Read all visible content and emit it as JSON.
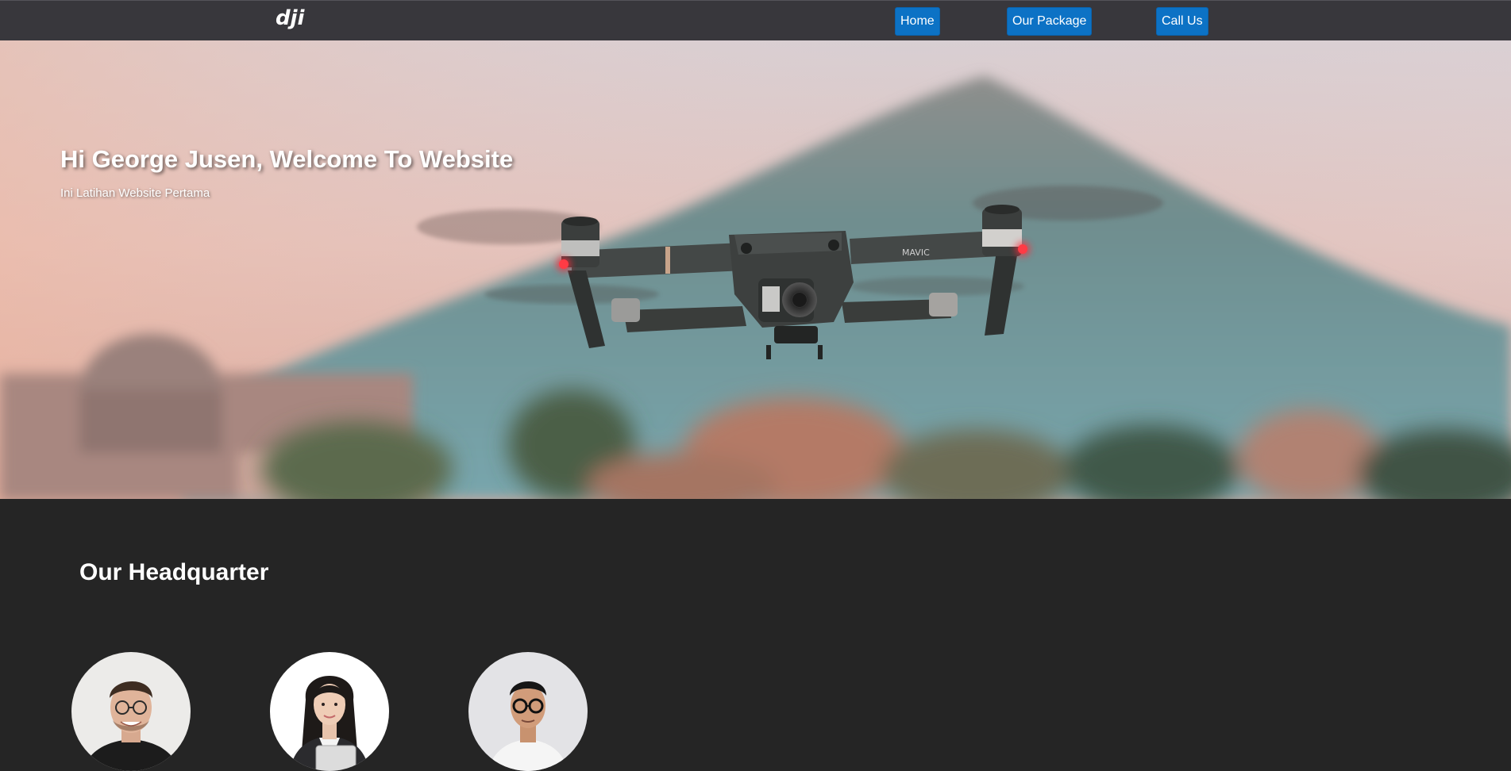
{
  "navbar": {
    "logo_text": "dji",
    "items": [
      {
        "label": "Home"
      },
      {
        "label": "Our Package"
      },
      {
        "label": "Call Us"
      }
    ]
  },
  "hero": {
    "title": "Hi George Jusen, Welcome To Website",
    "subtitle": "Ini Latihan Website Pertama",
    "drone_label": "MAVIC"
  },
  "headquarter": {
    "title": "Our Headquarter",
    "members": [
      {
        "icon": "person-avatar"
      },
      {
        "icon": "person-avatar"
      },
      {
        "icon": "person-avatar"
      }
    ]
  },
  "colors": {
    "navbar_bg": "#38373c",
    "nav_button_bg": "#0c72c5",
    "page_bg": "#252525"
  }
}
